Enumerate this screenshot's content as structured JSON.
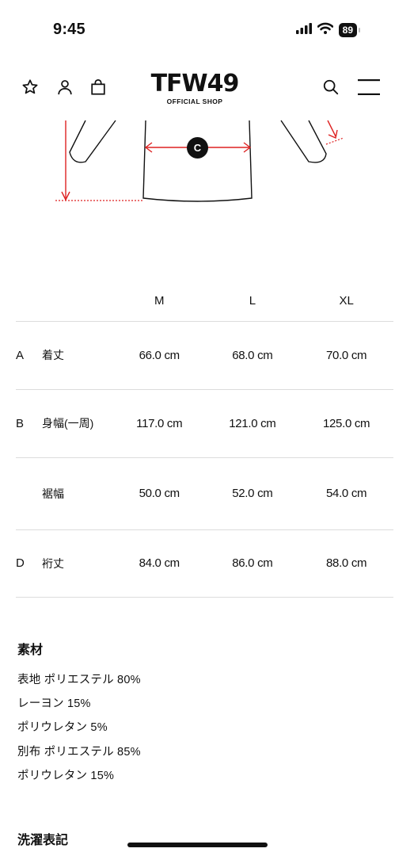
{
  "status_bar": {
    "time": "9:45",
    "battery": "89"
  },
  "header": {
    "logo": "TFW49",
    "logo_sub": "OFFICIAL SHOP"
  },
  "diagram": {
    "marker": "C"
  },
  "size_table": {
    "headers": [
      "M",
      "L",
      "XL"
    ],
    "rows": [
      {
        "code": "A",
        "label": "着丈",
        "values": [
          "66.0 cm",
          "68.0 cm",
          "70.0 cm"
        ]
      },
      {
        "code": "B",
        "label": "身幅(一周)",
        "values": [
          "117.0 cm",
          "121.0 cm",
          "125.0 cm"
        ]
      },
      {
        "code": "",
        "label": "裾幅",
        "values": [
          "50.0 cm",
          "52.0 cm",
          "54.0 cm"
        ]
      },
      {
        "code": "D",
        "label": "裄丈",
        "values": [
          "84.0 cm",
          "86.0 cm",
          "88.0 cm"
        ]
      }
    ]
  },
  "material": {
    "title": "素材",
    "lines": [
      "表地 ポリエステル 80%",
      "レーヨン 15%",
      "ポリウレタン 5%",
      "別布 ポリエステル 85%",
      "ポリウレタン 15%"
    ]
  },
  "care": {
    "title": "洗濯表記"
  }
}
